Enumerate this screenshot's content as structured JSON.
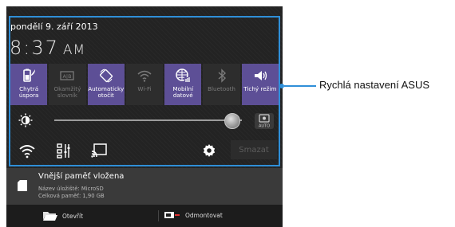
{
  "status": {
    "date": "pondělí 9. září 2013",
    "time": "8:37",
    "ampm": "AM"
  },
  "tiles": [
    {
      "label": "Chytrá\núspora",
      "icon": "battery-saver-icon",
      "state": "on"
    },
    {
      "label": "Okamžitý\nslovník",
      "icon": "dictionary-icon",
      "state": "off"
    },
    {
      "label": "Automaticky\notočit",
      "icon": "auto-rotate-icon",
      "state": "on"
    },
    {
      "label": "Wi-Fi",
      "icon": "wifi-icon",
      "state": "off"
    },
    {
      "label": "Mobilní\ndatové",
      "icon": "mobile-data-icon",
      "state": "on"
    },
    {
      "label": "Bluetooth",
      "icon": "bluetooth-icon",
      "state": "off"
    },
    {
      "label": "Tichý režim",
      "icon": "silent-mode-icon",
      "state": "on"
    }
  ],
  "brightness": {
    "level": 0.96,
    "auto_label": "AUTO"
  },
  "bottom_row": {
    "clear_label": "Smazat"
  },
  "notification": {
    "title": "Vnější paměť vložena",
    "line1": "Název úložiště: MicroSD",
    "line2": "Celková paměť: 1,90 GB",
    "open_label": "Otevřít",
    "unmount_label": "Odmontovat"
  },
  "callout": {
    "label": "Rychlá nastavení ASUS"
  },
  "colors": {
    "accent": "#2f8fd8",
    "tile_on": "#5d4f96",
    "tile_off": "#2d2d2d"
  }
}
